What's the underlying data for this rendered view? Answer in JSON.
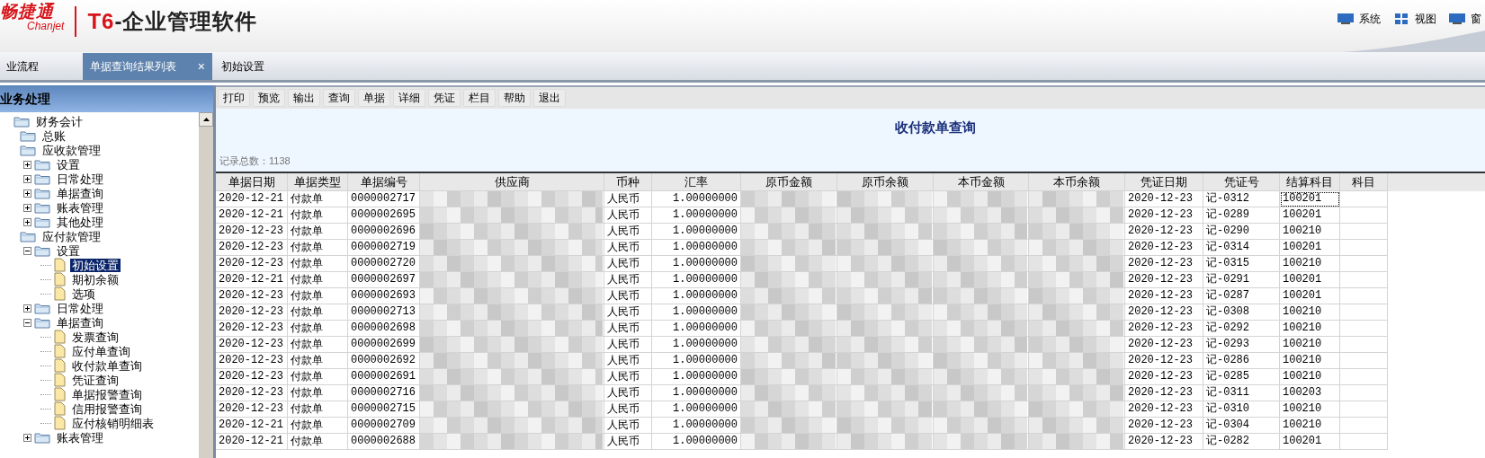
{
  "header": {
    "logo_cn": "畅捷通",
    "logo_en": "Chanjet",
    "product_code": "T6",
    "product_name": "-企业管理软件",
    "menu": [
      {
        "label": "系统"
      },
      {
        "label": "视图"
      },
      {
        "label": "窗"
      }
    ]
  },
  "tabs": [
    {
      "label": "业流程",
      "selected": false
    },
    {
      "label": "单据查询结果列表",
      "selected": true,
      "close": "×"
    },
    {
      "label": "初始设置",
      "selected": false
    }
  ],
  "sidebar": {
    "title": "业务处理",
    "tree": [
      {
        "label": "财务会计",
        "kind": "folder",
        "selected": false,
        "children": [
          {
            "label": "总账",
            "kind": "folder",
            "selected": false
          },
          {
            "label": "应收款管理",
            "kind": "folder",
            "selected": false,
            "children": [
              {
                "label": "设置",
                "kind": "folder",
                "selected": false,
                "expanded": false
              },
              {
                "label": "日常处理",
                "kind": "folder",
                "selected": false,
                "expanded": false
              },
              {
                "label": "单据查询",
                "kind": "folder",
                "selected": false,
                "expanded": false
              },
              {
                "label": "账表管理",
                "kind": "folder",
                "selected": false,
                "expanded": false
              },
              {
                "label": "其他处理",
                "kind": "folder",
                "selected": false,
                "expanded": false
              }
            ]
          },
          {
            "label": "应付款管理",
            "kind": "folder",
            "selected": false,
            "children": [
              {
                "label": "设置",
                "kind": "folder",
                "selected": false,
                "expanded": true,
                "children": [
                  {
                    "label": "初始设置",
                    "kind": "doc",
                    "selected": true
                  },
                  {
                    "label": "期初余额",
                    "kind": "doc",
                    "selected": false
                  },
                  {
                    "label": "选项",
                    "kind": "doc",
                    "selected": false
                  }
                ]
              },
              {
                "label": "日常处理",
                "kind": "folder",
                "selected": false,
                "expanded": false
              },
              {
                "label": "单据查询",
                "kind": "folder",
                "selected": false,
                "expanded": true,
                "children": [
                  {
                    "label": "发票查询",
                    "kind": "doc",
                    "selected": false
                  },
                  {
                    "label": "应付单查询",
                    "kind": "doc",
                    "selected": false
                  },
                  {
                    "label": "收付款单查询",
                    "kind": "doc",
                    "selected": false
                  },
                  {
                    "label": "凭证查询",
                    "kind": "doc",
                    "selected": false
                  },
                  {
                    "label": "单据报警查询",
                    "kind": "doc",
                    "selected": false
                  },
                  {
                    "label": "信用报警查询",
                    "kind": "doc",
                    "selected": false
                  },
                  {
                    "label": "应付核销明细表",
                    "kind": "doc",
                    "selected": false
                  }
                ]
              },
              {
                "label": "账表管理",
                "kind": "folder",
                "selected": false,
                "expanded": false
              }
            ]
          }
        ]
      }
    ]
  },
  "toolbar": [
    "打印",
    "预览",
    "输出",
    "查询",
    "单据",
    "详细",
    "凭证",
    "栏目",
    "帮助",
    "退出"
  ],
  "report": {
    "title": "收付款单查询",
    "record_count": "记录总数：1138"
  },
  "table": {
    "columns": [
      "单据日期",
      "单据类型",
      "单据编号",
      "供应商",
      "币种",
      "汇率",
      "原币金额",
      "原币余额",
      "本币金额",
      "本币余额",
      "凭证日期",
      "凭证号",
      "结算科目",
      "科目"
    ],
    "rows": [
      {
        "date": "2020-12-21",
        "type": "付款单",
        "number": "0000002717",
        "currency": "人民币",
        "rate": "1.00000000",
        "voucher_date": "2020-12-23",
        "voucher_no": "记-0312",
        "settle_account": "100201",
        "focused": true
      },
      {
        "date": "2020-12-21",
        "type": "付款单",
        "number": "0000002695",
        "currency": "人民币",
        "rate": "1.00000000",
        "voucher_date": "2020-12-23",
        "voucher_no": "记-0289",
        "settle_account": "100201",
        "focused": false
      },
      {
        "date": "2020-12-23",
        "type": "付款单",
        "number": "0000002696",
        "currency": "人民币",
        "rate": "1.00000000",
        "voucher_date": "2020-12-23",
        "voucher_no": "记-0290",
        "settle_account": "100210",
        "focused": false
      },
      {
        "date": "2020-12-23",
        "type": "付款单",
        "number": "0000002719",
        "currency": "人民币",
        "rate": "1.00000000",
        "voucher_date": "2020-12-23",
        "voucher_no": "记-0314",
        "settle_account": "100201",
        "focused": false
      },
      {
        "date": "2020-12-23",
        "type": "付款单",
        "number": "0000002720",
        "currency": "人民币",
        "rate": "1.00000000",
        "voucher_date": "2020-12-23",
        "voucher_no": "记-0315",
        "settle_account": "100210",
        "focused": false
      },
      {
        "date": "2020-12-21",
        "type": "付款单",
        "number": "0000002697",
        "currency": "人民币",
        "rate": "1.00000000",
        "voucher_date": "2020-12-23",
        "voucher_no": "记-0291",
        "settle_account": "100201",
        "focused": false
      },
      {
        "date": "2020-12-23",
        "type": "付款单",
        "number": "0000002693",
        "currency": "人民币",
        "rate": "1.00000000",
        "voucher_date": "2020-12-23",
        "voucher_no": "记-0287",
        "settle_account": "100201",
        "focused": false
      },
      {
        "date": "2020-12-23",
        "type": "付款单",
        "number": "0000002713",
        "currency": "人民币",
        "rate": "1.00000000",
        "voucher_date": "2020-12-23",
        "voucher_no": "记-0308",
        "settle_account": "100210",
        "focused": false
      },
      {
        "date": "2020-12-23",
        "type": "付款单",
        "number": "0000002698",
        "currency": "人民币",
        "rate": "1.00000000",
        "voucher_date": "2020-12-23",
        "voucher_no": "记-0292",
        "settle_account": "100210",
        "focused": false
      },
      {
        "date": "2020-12-23",
        "type": "付款单",
        "number": "0000002699",
        "currency": "人民币",
        "rate": "1.00000000",
        "voucher_date": "2020-12-23",
        "voucher_no": "记-0293",
        "settle_account": "100210",
        "focused": false
      },
      {
        "date": "2020-12-23",
        "type": "付款单",
        "number": "0000002692",
        "currency": "人民币",
        "rate": "1.00000000",
        "voucher_date": "2020-12-23",
        "voucher_no": "记-0286",
        "settle_account": "100210",
        "focused": false
      },
      {
        "date": "2020-12-23",
        "type": "付款单",
        "number": "0000002691",
        "currency": "人民币",
        "rate": "1.00000000",
        "voucher_date": "2020-12-23",
        "voucher_no": "记-0285",
        "settle_account": "100210",
        "focused": false
      },
      {
        "date": "2020-12-23",
        "type": "付款单",
        "number": "0000002716",
        "currency": "人民币",
        "rate": "1.00000000",
        "voucher_date": "2020-12-23",
        "voucher_no": "记-0311",
        "settle_account": "100203",
        "focused": false
      },
      {
        "date": "2020-12-23",
        "type": "付款单",
        "number": "0000002715",
        "currency": "人民币",
        "rate": "1.00000000",
        "voucher_date": "2020-12-23",
        "voucher_no": "记-0310",
        "settle_account": "100210",
        "focused": false
      },
      {
        "date": "2020-12-21",
        "type": "付款单",
        "number": "0000002709",
        "currency": "人民币",
        "rate": "1.00000000",
        "voucher_date": "2020-12-23",
        "voucher_no": "记-0304",
        "settle_account": "100210",
        "focused": false
      },
      {
        "date": "2020-12-21",
        "type": "付款单",
        "number": "0000002688",
        "currency": "人民币",
        "rate": "1.00000000",
        "voucher_date": "2020-12-23",
        "voucher_no": "记-0282",
        "settle_account": "100201",
        "focused": false
      }
    ]
  }
}
